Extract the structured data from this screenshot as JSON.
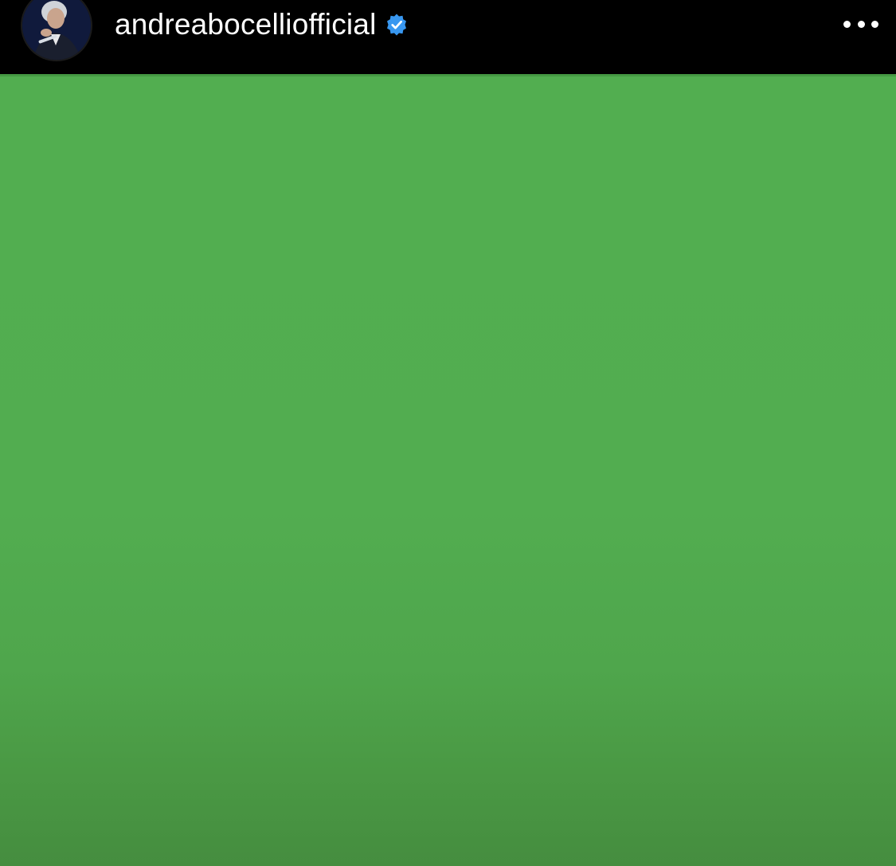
{
  "post": {
    "username": "andreabocelliofficial",
    "verified": true,
    "verified_color": "#3897f0",
    "avatar_icon": "profile-photo",
    "more_icon": "more-options-icon"
  },
  "media": {
    "color": "#52ad50"
  }
}
